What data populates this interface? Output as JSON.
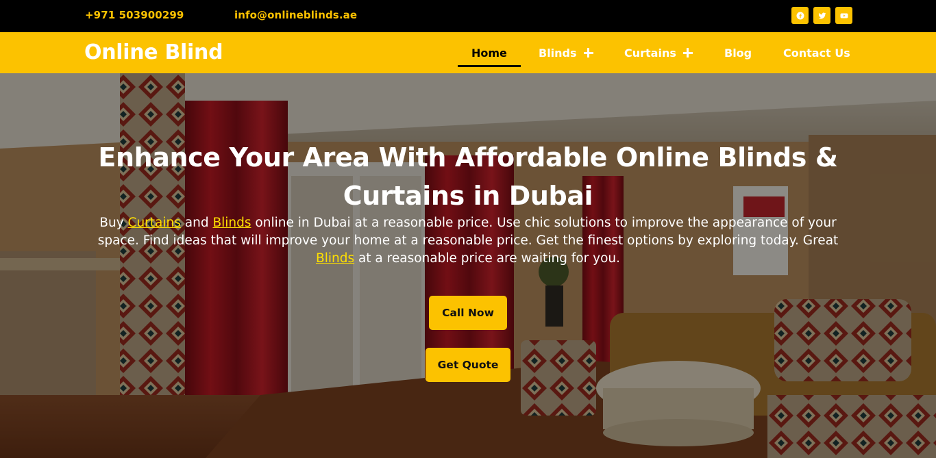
{
  "topbar": {
    "phone": "+971 503900299",
    "email": "info@onlineblinds.ae",
    "social": [
      {
        "icon": "facebook-icon"
      },
      {
        "icon": "twitter-icon"
      },
      {
        "icon": "youtube-icon"
      }
    ]
  },
  "nav": {
    "logo": "Online Blind",
    "items": [
      {
        "label": "Home",
        "active": true
      },
      {
        "label": "Blinds",
        "has_submenu": true
      },
      {
        "label": "Curtains",
        "has_submenu": true
      },
      {
        "label": "Blog"
      },
      {
        "label": "Contact Us"
      }
    ]
  },
  "hero": {
    "title": "Enhance Your Area With Affordable Online Blinds & Curtains in Dubai",
    "text": {
      "t1": "Buy ",
      "link1": "Curtains",
      "t2": " and ",
      "link2": "Blinds",
      "t3": " online in Dubai at a reasonable price. Use chic solutions to improve the appearance of your space. Find ideas that will improve your home at a reasonable price. Get the finest options by exploring today. Great ",
      "link3": "Blinds",
      "t4": " at a reasonable price are waiting for you."
    },
    "buttons": {
      "call": "Call Now",
      "quote": "Get Quote"
    }
  },
  "colors": {
    "accent": "#fcc200",
    "topbar_bg": "#000000",
    "link": "#ffe000"
  }
}
